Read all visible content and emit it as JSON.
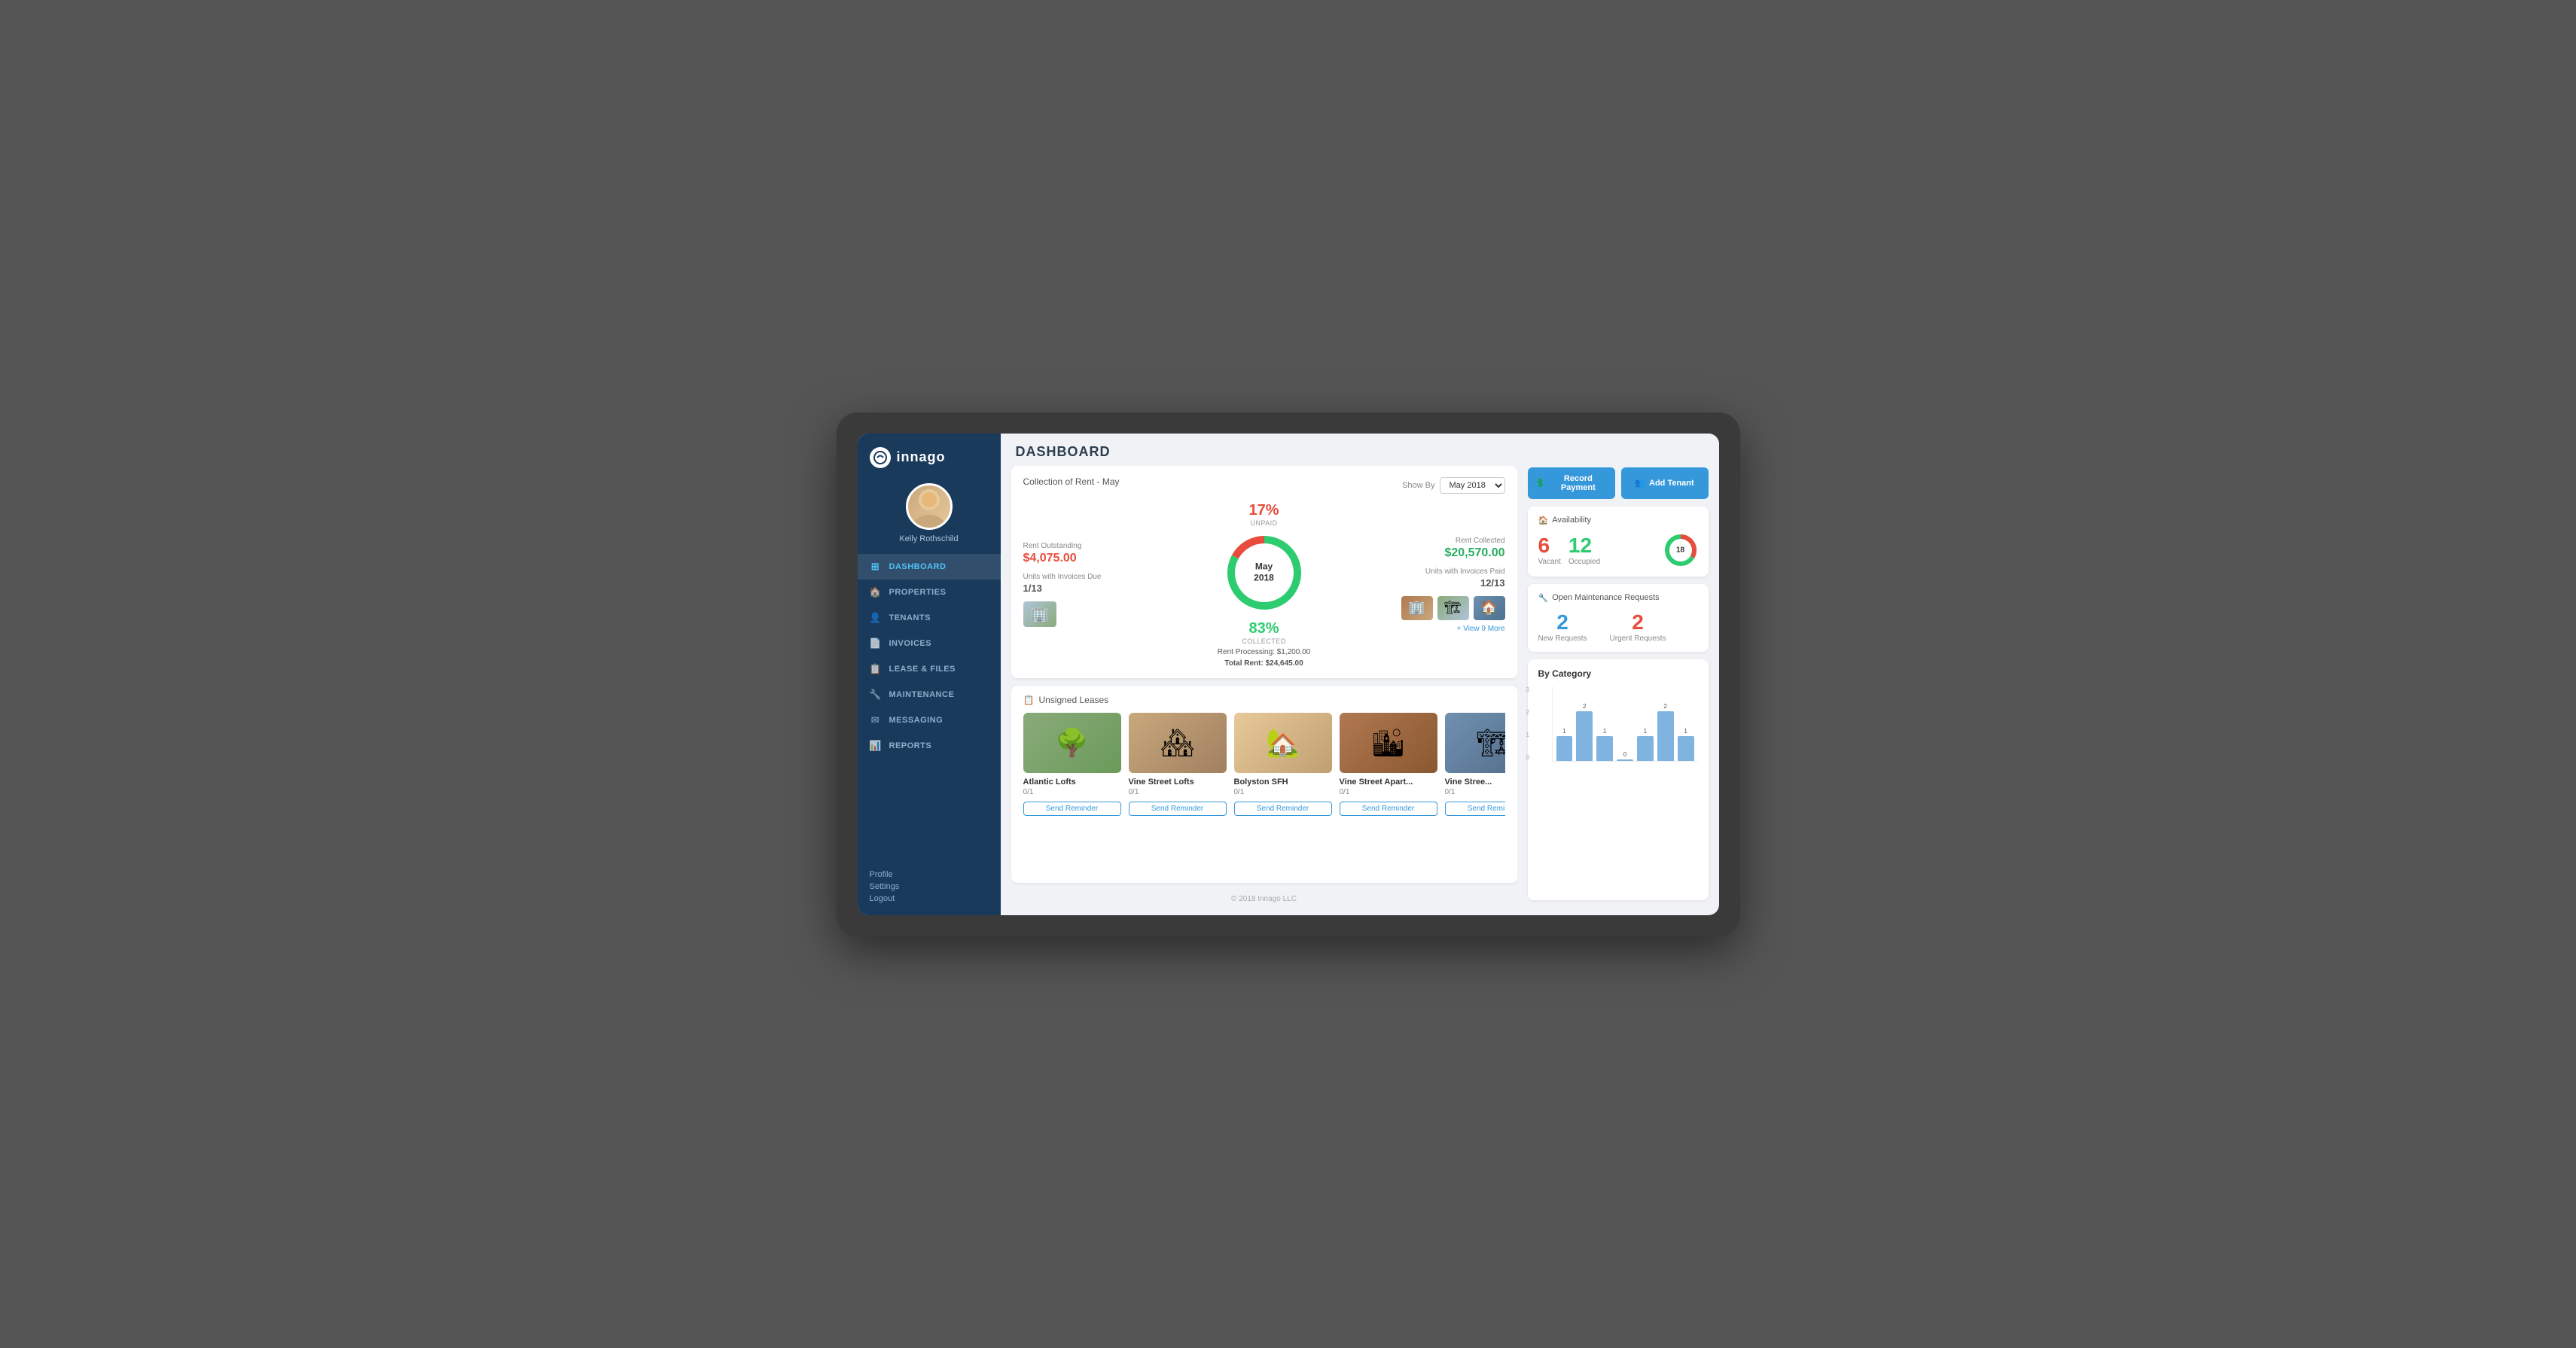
{
  "app": {
    "name": "innago",
    "user": "Kelly Rothschild",
    "page_title": "DASHBOARD"
  },
  "sidebar": {
    "nav_items": [
      {
        "id": "dashboard",
        "label": "DASHBOARD",
        "icon": "⊞",
        "active": true
      },
      {
        "id": "properties",
        "label": "PROPERTIES",
        "icon": "🏠",
        "active": false
      },
      {
        "id": "tenants",
        "label": "TENANTS",
        "icon": "👤",
        "active": false
      },
      {
        "id": "invoices",
        "label": "INVOICES",
        "icon": "📄",
        "active": false
      },
      {
        "id": "lease-files",
        "label": "LEASE & FILES",
        "icon": "📋",
        "active": false
      },
      {
        "id": "maintenance",
        "label": "MAINTENANCE",
        "icon": "🔧",
        "active": false
      },
      {
        "id": "messaging",
        "label": "MESSAGING",
        "icon": "✉",
        "active": false
      },
      {
        "id": "reports",
        "label": "REPORTS",
        "icon": "📊",
        "active": false
      }
    ],
    "footer_links": [
      "Profile",
      "Settings",
      "Logout"
    ]
  },
  "header": {
    "record_payment_label": "Record Payment",
    "add_tenant_label": "Add Tenant"
  },
  "rent_collection": {
    "title": "Collection of Rent - May",
    "show_by_label": "Show By",
    "month_option": "May 2018",
    "outstanding_label": "Rent Outstanding",
    "outstanding_value": "$4,075.00",
    "unpaid_pct": "17%",
    "unpaid_label": "UNPAID",
    "collected_pct": "83%",
    "collected_label": "COLLECTED",
    "donut_label": "May",
    "donut_label2": "2018",
    "units_due_label": "Units with Invoices Due",
    "units_due_value": "1/13",
    "rent_processing_label": "Rent Processing: $1,200.00",
    "total_rent_label": "Total Rent: $24,645.00",
    "rent_collected_label": "Rent Collected",
    "rent_collected_value": "$20,570.00",
    "units_paid_label": "Units with Invoices Paid",
    "units_paid_value": "12/13",
    "view_more_label": "+ View 9 More"
  },
  "unsigned_leases": {
    "title": "Unsigned Leases",
    "properties": [
      {
        "name": "Atlantic Lofts",
        "count": "0/1",
        "color": "#8aab7a"
      },
      {
        "name": "Vine Street Lofts",
        "count": "0/1",
        "color": "#c9a87c"
      },
      {
        "name": "Bolyston SFH",
        "count": "0/1",
        "color": "#e8c99a"
      },
      {
        "name": "Vine Street Apart...",
        "count": "0/1",
        "color": "#b07850"
      },
      {
        "name": "Vine Stree...",
        "count": "0/1",
        "color": "#7090b0"
      }
    ],
    "send_reminder_label": "Send Reminder"
  },
  "availability": {
    "title": "Availability",
    "vacant_count": "6",
    "vacant_label": "Vacant",
    "occupied_count": "12",
    "occupied_label": "Occupied",
    "total": "18",
    "vacant_pct": 33,
    "occupied_pct": 67
  },
  "maintenance": {
    "title": "Open Maintenance Requests",
    "new_requests_count": "2",
    "new_requests_label": "New Requests",
    "urgent_requests_count": "2",
    "urgent_requests_label": "Urgent Requests"
  },
  "category_chart": {
    "title": "By Category",
    "y_labels": [
      "3",
      "2",
      "1",
      "0"
    ],
    "bars": [
      {
        "value": 1,
        "height": 33
      },
      {
        "value": 2,
        "height": 66
      },
      {
        "value": 1,
        "height": 33
      },
      {
        "value": 0,
        "height": 2
      },
      {
        "value": 1,
        "height": 33
      },
      {
        "value": 2,
        "height": 66
      },
      {
        "value": 1,
        "height": 33
      }
    ]
  },
  "footer": {
    "copyright": "© 2018 Innago LLC"
  }
}
